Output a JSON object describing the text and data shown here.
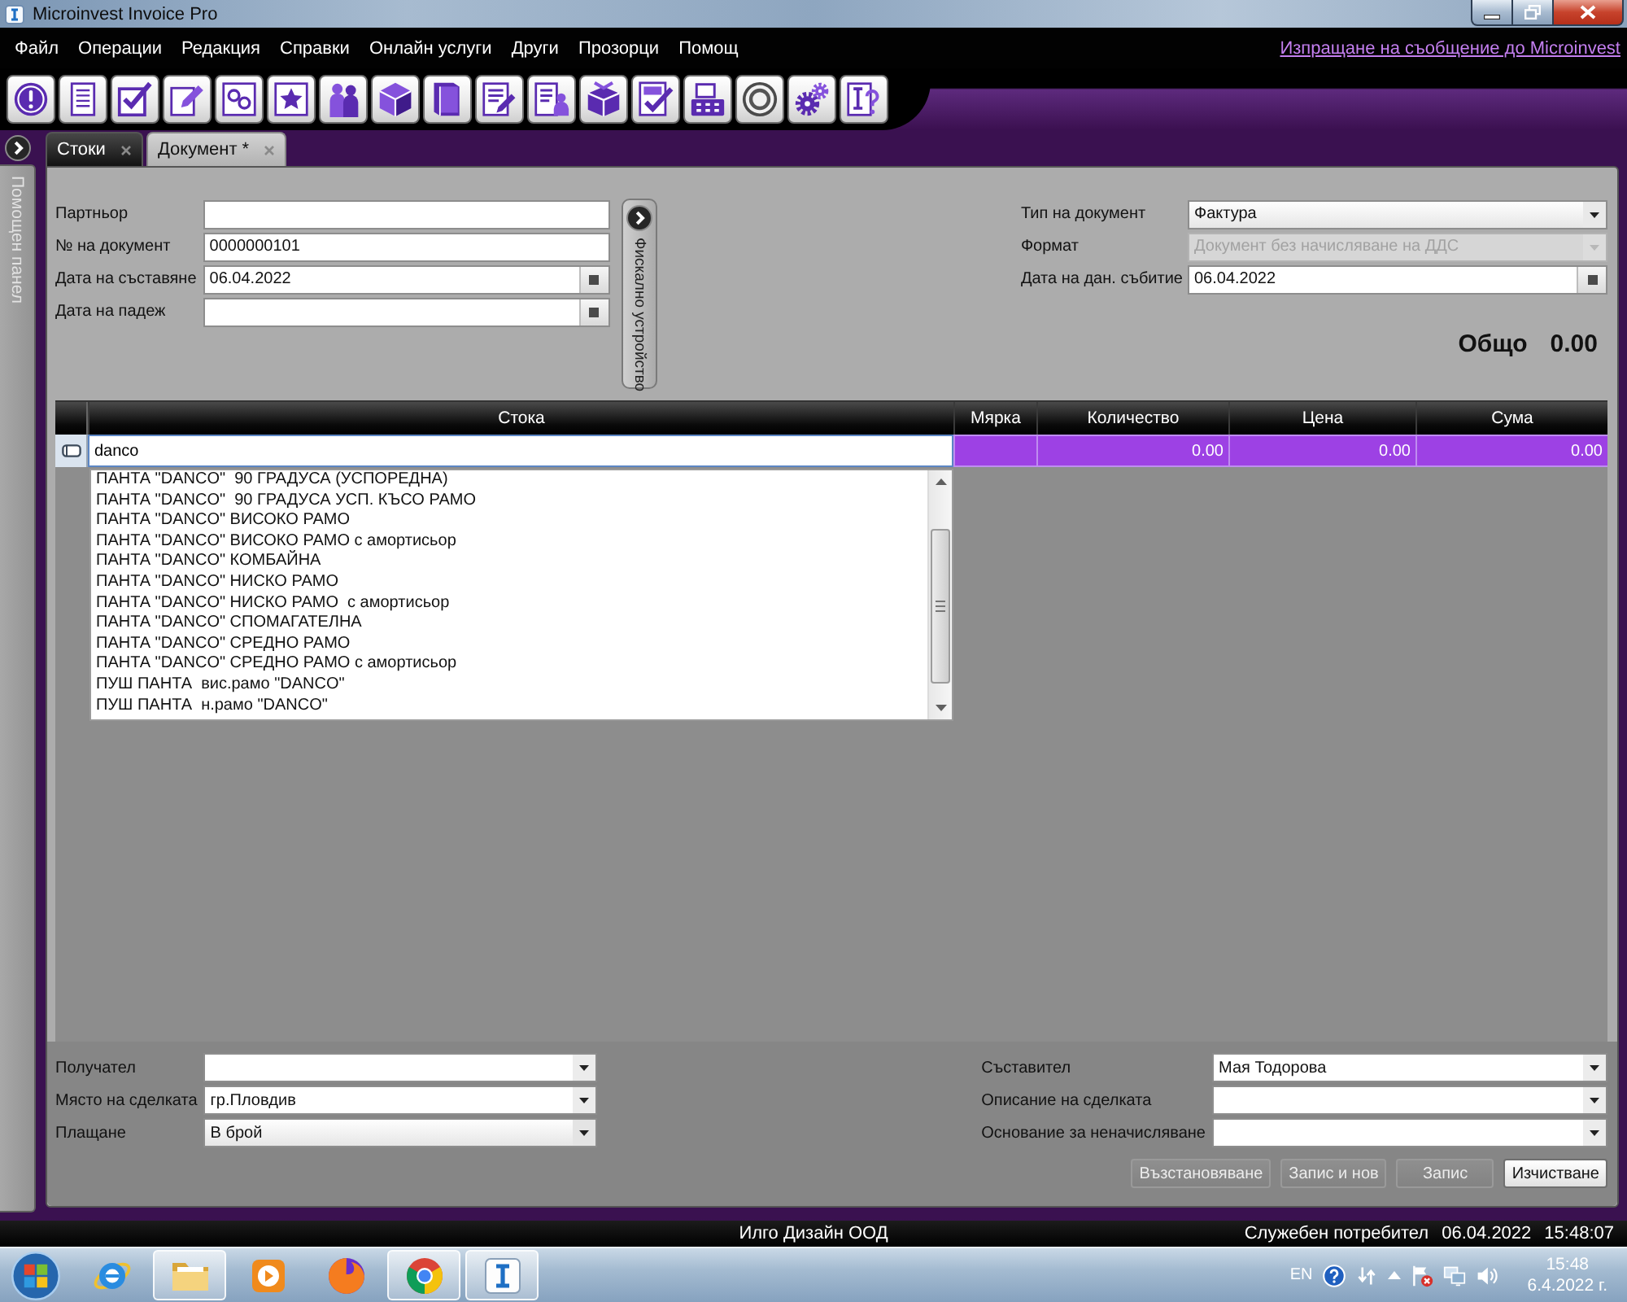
{
  "window": {
    "title": "Microinvest Invoice Pro"
  },
  "menu": {
    "items": [
      "Файл",
      "Операции",
      "Редакция",
      "Справки",
      "Онлайн услуги",
      "Други",
      "Прозорци",
      "Помощ"
    ],
    "link": "Изпращане на съобщение до Microinvest"
  },
  "help_panel": {
    "label": "Помощен панел"
  },
  "tabs": [
    {
      "label": "Стоки",
      "selected": false
    },
    {
      "label": "Документ *",
      "selected": true
    }
  ],
  "document_fields": [
    {
      "label": "Партньор",
      "kind": "text"
    },
    {
      "label": "№ на документ",
      "value": "0000000101",
      "kind": "text"
    },
    {
      "label": "Дата на съставяне",
      "value": "06.04.2022",
      "kind": "date"
    },
    {
      "label": "Дата на падеж",
      "kind": "date"
    }
  ],
  "fiscal_device_button": {
    "label": "Фискално устройство"
  },
  "document_settings": [
    {
      "label": "Тип на документ",
      "value": "Фактура",
      "kind": "select",
      "disabled": false
    },
    {
      "label": "Формат",
      "value": "Документ без начисляване на ДДС",
      "kind": "select",
      "disabled": true
    },
    {
      "label": "Дата на дан. събитие",
      "value": "06.04.2022",
      "kind": "date",
      "disabled": false
    }
  ],
  "total": {
    "label": "Общо",
    "value": "0.00"
  },
  "table": {
    "columns": [
      "Стока",
      "Мярка",
      "Количество",
      "Цена",
      "Сума"
    ],
    "rows": [
      {
        "selected": true,
        "cells": [
          {
            "value": "danco",
            "editing": true
          },
          {
            "editing": false
          },
          {
            "value": "0.00",
            "editing": false
          },
          {
            "value": "0.00",
            "editing": false
          },
          {
            "value": "0.00",
            "editing": false
          }
        ]
      }
    ]
  },
  "autocomplete": {
    "items": [
      "ПАНТА \"DANCO\"  90 ГРАДУСА (УСПОРЕДНА)",
      "ПАНТА \"DANCO\"  90 ГРАДУСА УСП. КЪСО РАМО",
      "ПАНТА \"DANCO\" ВИСОКО РАМО",
      "ПАНТА \"DANCO\" ВИСОКО РАМО с амортисьор",
      "ПАНТА \"DANCO\" КОМБАЙНА",
      "ПАНТА \"DANCO\" НИСКО РАМО",
      "ПАНТА \"DANCO\" НИСКО РАМО  с амортисьор",
      "ПАНТА \"DANCO\" СПОМАГАТЕЛНА",
      "ПАНТА \"DANCO\" СРЕДНО РАМО",
      "ПАНТА \"DANCO\" СРЕДНО РАМО с амортисьор",
      "ПУШ ПАНТА  вис.рамо \"DANCO\"",
      "ПУШ ПАНТА  н.рамо \"DANCO\""
    ]
  },
  "deal_fields": [
    {
      "label": "Получател",
      "kind": "dropdown"
    },
    {
      "label": "Място на сделката",
      "value": "гр.Пловдив",
      "kind": "dropdown"
    },
    {
      "label": "Плащане",
      "value": "В брой",
      "kind": "select"
    }
  ],
  "author_fields": [
    {
      "label": "Съставител",
      "value": "Мая Тодорова",
      "kind": "dropdown"
    },
    {
      "label": "Описание на сделката",
      "kind": "dropdown"
    },
    {
      "label": "Основание за неначисляване",
      "kind": "dropdown"
    }
  ],
  "buttons": [
    {
      "label": "Възстановяване",
      "disabled": true
    },
    {
      "label": "Запис и нов",
      "disabled": true
    },
    {
      "label": "Запис",
      "disabled": true
    },
    {
      "label": "Изчистване",
      "disabled": false
    }
  ],
  "status_bar": {
    "company": "Илго Дизайн ООД",
    "user": "Служебен потребител",
    "date": "06.04.2022",
    "time": "15:48:07"
  },
  "taskbar": {
    "apps": [
      {
        "running": false
      },
      {
        "running": true
      },
      {
        "running": false
      },
      {
        "running": false
      },
      {
        "running": true
      },
      {
        "running": true
      }
    ],
    "language": "EN",
    "time": "15:48",
    "date": "6.4.2022 г."
  }
}
